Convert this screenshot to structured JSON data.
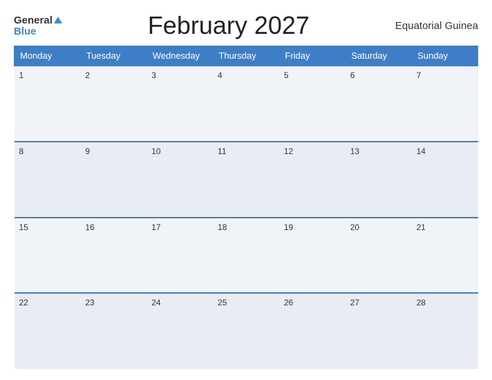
{
  "header": {
    "logo_general": "General",
    "logo_blue": "Blue",
    "title": "February 2027",
    "country": "Equatorial Guinea"
  },
  "calendar": {
    "days_of_week": [
      "Monday",
      "Tuesday",
      "Wednesday",
      "Thursday",
      "Friday",
      "Saturday",
      "Sunday"
    ],
    "weeks": [
      [
        {
          "day": "1"
        },
        {
          "day": "2"
        },
        {
          "day": "3"
        },
        {
          "day": "4"
        },
        {
          "day": "5"
        },
        {
          "day": "6"
        },
        {
          "day": "7"
        }
      ],
      [
        {
          "day": "8"
        },
        {
          "day": "9"
        },
        {
          "day": "10"
        },
        {
          "day": "11"
        },
        {
          "day": "12"
        },
        {
          "day": "13"
        },
        {
          "day": "14"
        }
      ],
      [
        {
          "day": "15"
        },
        {
          "day": "16"
        },
        {
          "day": "17"
        },
        {
          "day": "18"
        },
        {
          "day": "19"
        },
        {
          "day": "20"
        },
        {
          "day": "21"
        }
      ],
      [
        {
          "day": "22"
        },
        {
          "day": "23"
        },
        {
          "day": "24"
        },
        {
          "day": "25"
        },
        {
          "day": "26"
        },
        {
          "day": "27"
        },
        {
          "day": "28"
        }
      ]
    ]
  }
}
